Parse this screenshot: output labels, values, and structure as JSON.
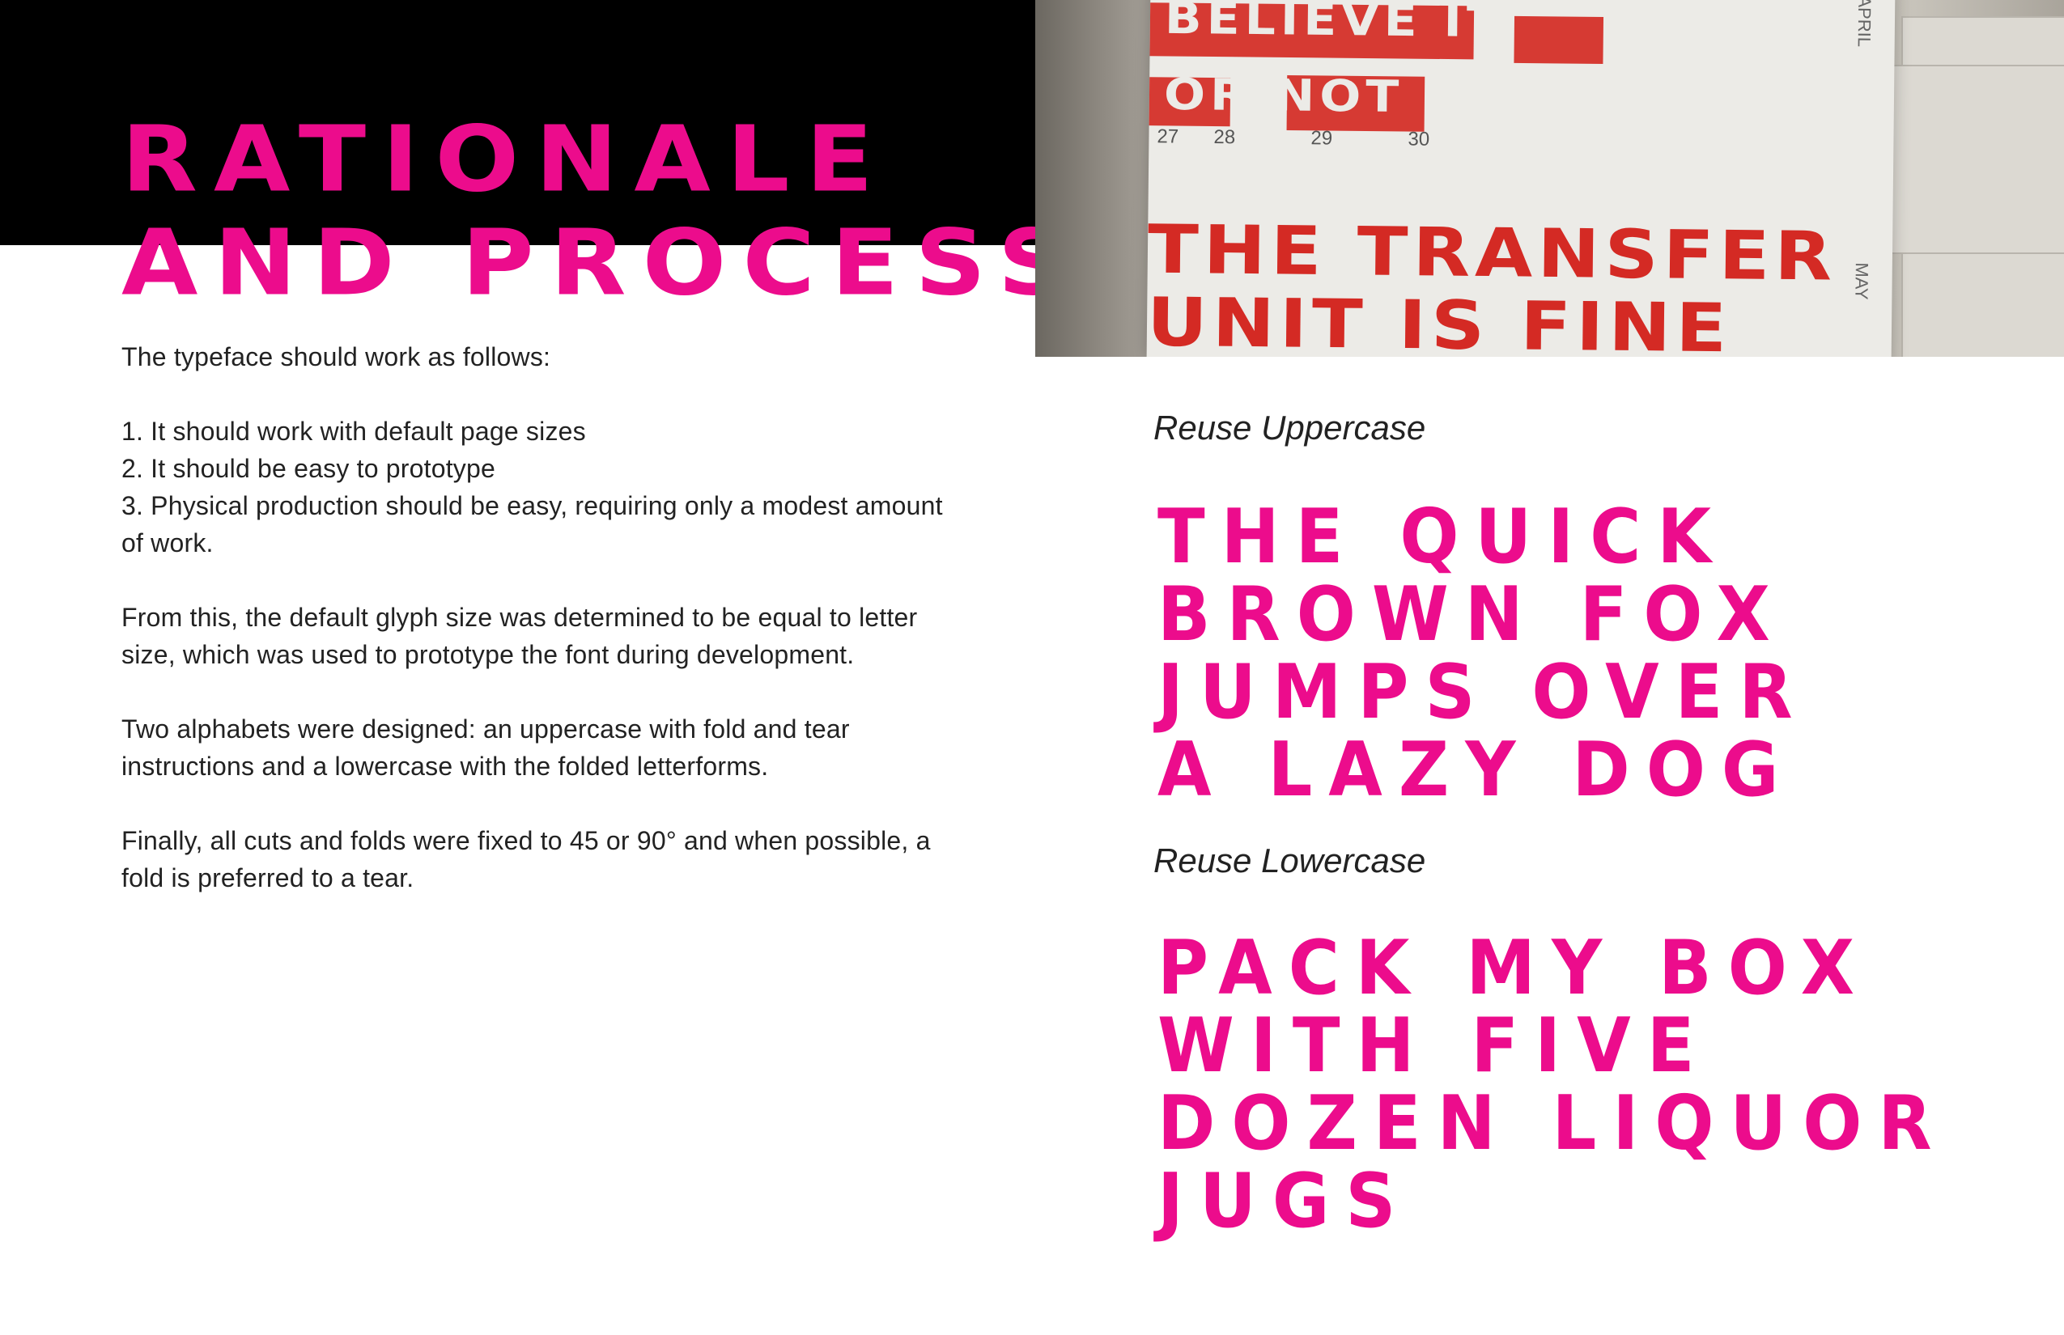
{
  "colors": {
    "accent": "#ec0c8c",
    "band": "#000000",
    "photo_ink": "#d42a24"
  },
  "title": {
    "lines": [
      "Rationale",
      "and Process"
    ]
  },
  "body": {
    "intro": "The typeface should work as follows:",
    "rules": [
      "1. It should work with default page sizes",
      "2. It should be easy to prototype",
      "3. Physical production should be easy, requiring only a modest amount of work."
    ],
    "para1": "From this, the default glyph size was determined to be equal to let­ter size, which was used to prototype the font during development.",
    "para2": "Two alphabets were designed: an uppercase with fold and tear instructions and a lowercase with the folded letterforms.",
    "para3": "Finally, all cuts and folds were fixed to 45 or 90° and when possible, a fold is preferred to a tear."
  },
  "photo": {
    "headline_lines": [
      "THE TRANSFER",
      "UNIT IS FINE"
    ],
    "top_words": [
      "BELIEVE IT",
      "OR NOT"
    ],
    "dates": [
      "27",
      "28",
      "29",
      "30"
    ],
    "side_labels": [
      "APRIL",
      "MAY"
    ]
  },
  "uppercase": {
    "label": "Reuse Uppercase",
    "lines": [
      "THE QUICK",
      "BROWN FOX",
      "JUMPS OVER",
      "A LAZY DOG"
    ]
  },
  "lowercase": {
    "label": "Reuse Lowercase",
    "lines": [
      "PACK MY BOX",
      "WITH FIVE",
      "DOZEN LIQUOR",
      "JUGS"
    ]
  }
}
